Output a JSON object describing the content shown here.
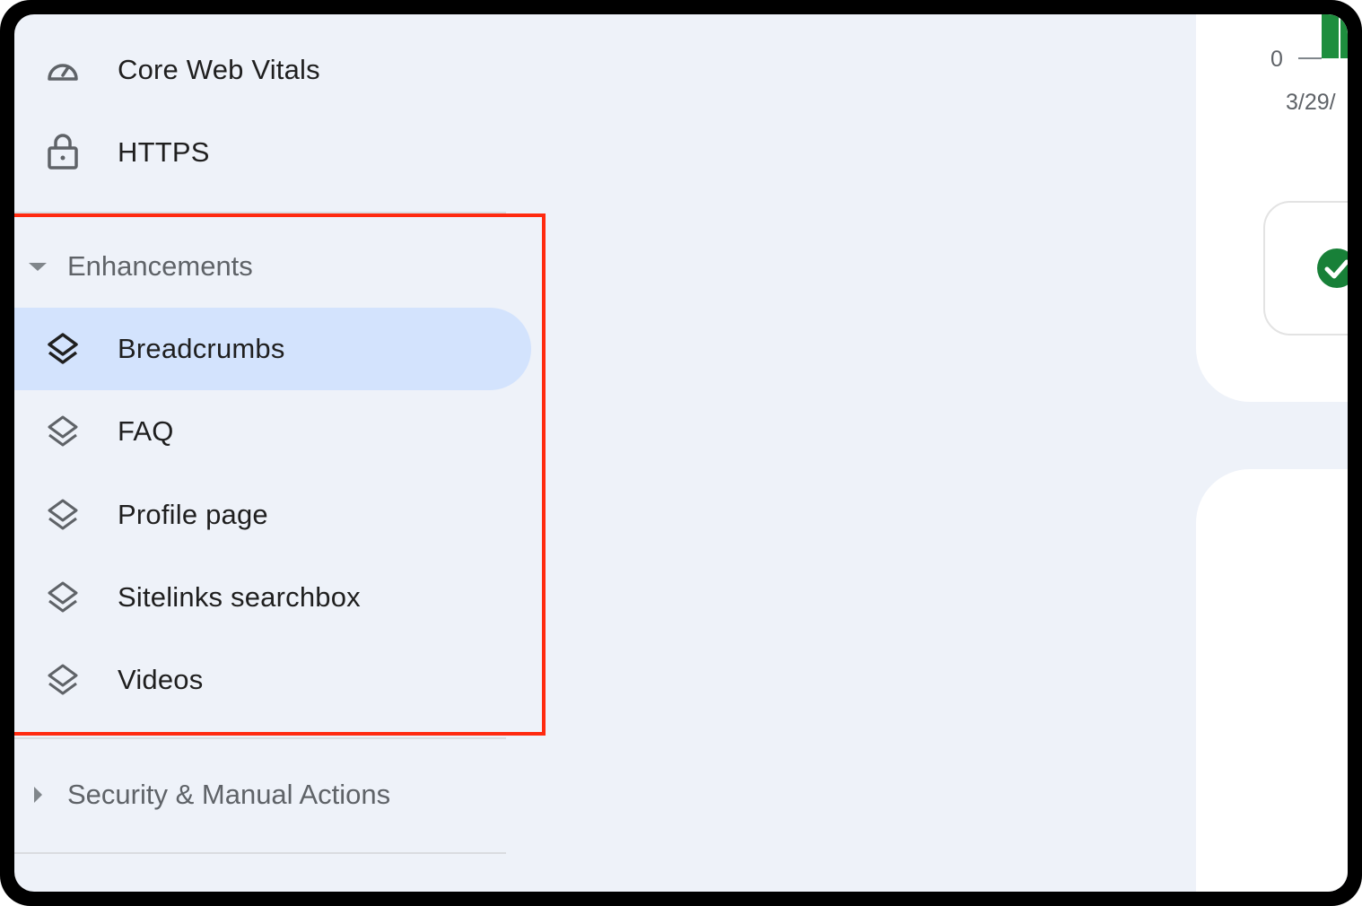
{
  "sidebar": {
    "top_items": [
      {
        "label": "Core Web Vitals",
        "icon": "speedometer-icon"
      },
      {
        "label": "HTTPS",
        "icon": "lock-icon"
      }
    ],
    "enhancements": {
      "title": "Enhancements",
      "expanded": true,
      "items": [
        {
          "label": "Breadcrumbs",
          "icon": "layers-icon",
          "active": true
        },
        {
          "label": "FAQ",
          "icon": "layers-icon"
        },
        {
          "label": "Profile page",
          "icon": "layers-icon"
        },
        {
          "label": "Sitelinks searchbox",
          "icon": "layers-icon"
        },
        {
          "label": "Videos",
          "icon": "layers-icon"
        }
      ]
    },
    "security": {
      "title": "Security & Manual Actions",
      "expanded": false
    }
  },
  "main": {
    "chart": {
      "y_tick": "0",
      "x_tick": "3/29/",
      "bar_color": "#1e8e3e"
    },
    "status_icon": "check-circle-icon",
    "status_color": "#188038"
  },
  "highlight_color": "#ff2a10"
}
